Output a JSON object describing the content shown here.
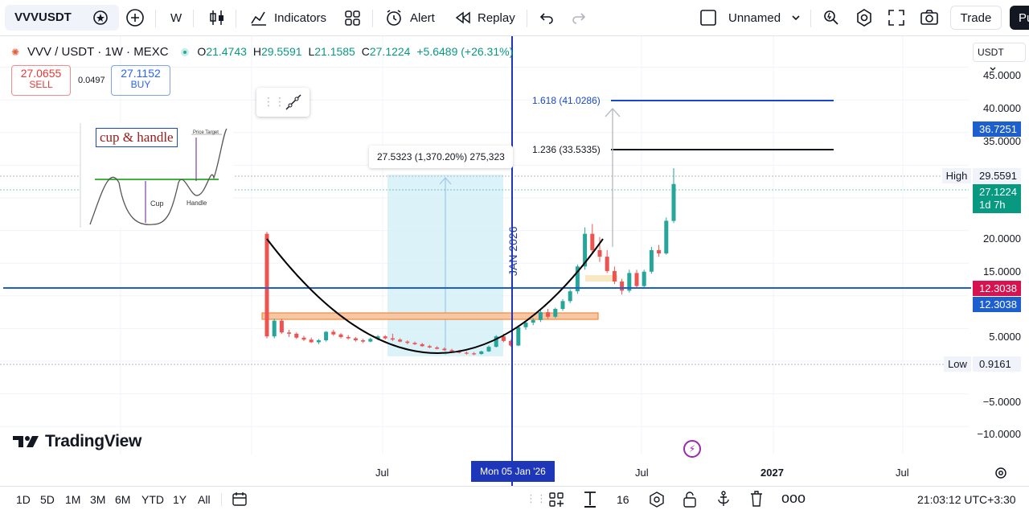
{
  "toolbar": {
    "symbol": "VVVUSDT",
    "interval": "W",
    "indicators_label": "Indicators",
    "alert_label": "Alert",
    "replay_label": "Replay",
    "layout_name": "Unnamed",
    "trade_label": "Trade",
    "publish_label": "Pu"
  },
  "legend": {
    "title": "VVV / USDT · 1W · MEXC",
    "o_key": "O",
    "o_val": "21.4743",
    "h_key": "H",
    "h_val": "29.5591",
    "l_key": "L",
    "l_val": "21.1585",
    "c_key": "C",
    "c_val": "27.1224",
    "change": "+5.6489 (+26.31%)"
  },
  "order": {
    "sell_price": "27.0655",
    "sell_label": "SELL",
    "spread": "0.0497",
    "buy_price": "27.1152",
    "buy_label": "BUY"
  },
  "annotations": {
    "cup_handle": "cup & handle",
    "price_target": "Price Target",
    "cup": "Cup",
    "handle": "Handle",
    "measure": "27.5323 (1,370.20%) 275,323",
    "fib_1618": "1.618 (41.0286)",
    "fib_1236": "1.236 (33.5335)",
    "vertical_label": "JAN 2026"
  },
  "price_axis": {
    "currency": "USDT",
    "ticks": [
      "45.0000",
      "40.0000",
      "35.0000",
      "20.0000",
      "15.0000",
      "5.0000",
      "−5.0000",
      "−10.0000"
    ],
    "tags": {
      "fib": "36.7251",
      "high_label": "High",
      "high": "29.5591",
      "last": "27.1224",
      "countdown": "1d 7h",
      "line_a": "12.3038",
      "line_b": "12.3038",
      "low_label": "Low",
      "low": "0.9161"
    }
  },
  "time_axis": {
    "labels": [
      "Jul",
      "Jul",
      "2027",
      "Jul"
    ],
    "crosshair": "Mon 05 Jan '26"
  },
  "branding": "TradingView",
  "bottom": {
    "ranges": [
      "1D",
      "5D",
      "1M",
      "3M",
      "6M",
      "YTD",
      "1Y",
      "All"
    ],
    "font_size": "16",
    "clock": "21:03:12 UTC+3:30"
  },
  "colors": {
    "up": "#26a69a",
    "down": "#ef5350",
    "blue": "#2962ff",
    "hline": "#1e5fd0",
    "fib_blue": "#1848cc",
    "tag_red": "#d6124f",
    "tag_blue": "#1e5fd0"
  },
  "chart_data": {
    "type": "candlestick",
    "title": "VVV / USDT · 1W · MEXC",
    "ylim": [
      -12,
      48
    ],
    "y_ticks": [
      45,
      40,
      35,
      20,
      15,
      5,
      -5,
      -10
    ],
    "candles": [
      {
        "o": 19.5,
        "h": 19.8,
        "l": 3.5,
        "c": 3.8
      },
      {
        "o": 3.8,
        "h": 6.5,
        "l": 3.5,
        "c": 6.2
      },
      {
        "o": 6.2,
        "h": 6.5,
        "l": 4.2,
        "c": 4.4
      },
      {
        "o": 4.4,
        "h": 4.8,
        "l": 3.7,
        "c": 4.2
      },
      {
        "o": 4.2,
        "h": 4.4,
        "l": 3.4,
        "c": 3.6
      },
      {
        "o": 3.6,
        "h": 3.9,
        "l": 3.1,
        "c": 3.3
      },
      {
        "o": 3.3,
        "h": 3.6,
        "l": 2.8,
        "c": 2.9
      },
      {
        "o": 2.9,
        "h": 3.4,
        "l": 2.6,
        "c": 3.2
      },
      {
        "o": 3.2,
        "h": 4.6,
        "l": 3.0,
        "c": 4.5
      },
      {
        "o": 4.5,
        "h": 4.8,
        "l": 3.9,
        "c": 4.1
      },
      {
        "o": 4.1,
        "h": 4.3,
        "l": 3.5,
        "c": 3.7
      },
      {
        "o": 3.7,
        "h": 4.0,
        "l": 3.3,
        "c": 3.5
      },
      {
        "o": 3.5,
        "h": 3.7,
        "l": 3.0,
        "c": 3.2
      },
      {
        "o": 3.2,
        "h": 3.4,
        "l": 2.8,
        "c": 3.0
      },
      {
        "o": 3.0,
        "h": 3.6,
        "l": 2.9,
        "c": 3.4
      },
      {
        "o": 3.4,
        "h": 4.0,
        "l": 3.2,
        "c": 3.8
      },
      {
        "o": 3.8,
        "h": 4.0,
        "l": 3.3,
        "c": 3.5
      },
      {
        "o": 3.5,
        "h": 4.2,
        "l": 3.1,
        "c": 3.3
      },
      {
        "o": 3.3,
        "h": 3.5,
        "l": 2.9,
        "c": 3.0
      },
      {
        "o": 3.0,
        "h": 3.2,
        "l": 2.6,
        "c": 2.8
      },
      {
        "o": 2.8,
        "h": 3.0,
        "l": 2.5,
        "c": 2.6
      },
      {
        "o": 2.6,
        "h": 2.8,
        "l": 2.2,
        "c": 2.3
      },
      {
        "o": 2.3,
        "h": 2.5,
        "l": 2.0,
        "c": 2.1
      },
      {
        "o": 2.1,
        "h": 2.3,
        "l": 1.8,
        "c": 1.9
      },
      {
        "o": 1.9,
        "h": 2.1,
        "l": 1.6,
        "c": 1.7
      },
      {
        "o": 1.7,
        "h": 1.9,
        "l": 1.4,
        "c": 1.5
      },
      {
        "o": 1.5,
        "h": 1.7,
        "l": 1.2,
        "c": 1.3
      },
      {
        "o": 1.3,
        "h": 1.5,
        "l": 1.0,
        "c": 1.2
      },
      {
        "o": 1.2,
        "h": 1.4,
        "l": 0.92,
        "c": 1.1
      },
      {
        "o": 1.1,
        "h": 1.6,
        "l": 1.0,
        "c": 1.5
      },
      {
        "o": 1.5,
        "h": 2.4,
        "l": 1.4,
        "c": 2.2
      },
      {
        "o": 2.2,
        "h": 4.0,
        "l": 2.1,
        "c": 3.8
      },
      {
        "o": 3.8,
        "h": 4.2,
        "l": 2.9,
        "c": 3.1
      },
      {
        "o": 3.1,
        "h": 3.3,
        "l": 2.2,
        "c": 2.4
      },
      {
        "o": 2.4,
        "h": 5.5,
        "l": 2.3,
        "c": 5.2
      },
      {
        "o": 5.2,
        "h": 6.2,
        "l": 4.8,
        "c": 5.9
      },
      {
        "o": 5.9,
        "h": 6.6,
        "l": 5.5,
        "c": 6.3
      },
      {
        "o": 6.3,
        "h": 7.8,
        "l": 6.0,
        "c": 7.5
      },
      {
        "o": 7.5,
        "h": 8.0,
        "l": 6.5,
        "c": 6.8
      },
      {
        "o": 6.8,
        "h": 8.2,
        "l": 6.6,
        "c": 8.0
      },
      {
        "o": 8.0,
        "h": 9.5,
        "l": 7.7,
        "c": 9.2
      },
      {
        "o": 9.2,
        "h": 11.0,
        "l": 8.9,
        "c": 10.7
      },
      {
        "o": 10.7,
        "h": 14.8,
        "l": 10.3,
        "c": 14.5
      },
      {
        "o": 14.5,
        "h": 20.5,
        "l": 14.0,
        "c": 19.5
      },
      {
        "o": 19.5,
        "h": 21.0,
        "l": 16.5,
        "c": 17.0
      },
      {
        "o": 17.0,
        "h": 19.0,
        "l": 15.2,
        "c": 16.0
      },
      {
        "o": 16.0,
        "h": 17.0,
        "l": 13.5,
        "c": 13.8
      },
      {
        "o": 13.8,
        "h": 14.5,
        "l": 11.8,
        "c": 12.2
      },
      {
        "o": 12.2,
        "h": 12.6,
        "l": 10.2,
        "c": 10.8
      },
      {
        "o": 10.8,
        "h": 14.0,
        "l": 10.5,
        "c": 13.5
      },
      {
        "o": 13.5,
        "h": 14.0,
        "l": 11.2,
        "c": 11.5
      },
      {
        "o": 11.5,
        "h": 14.0,
        "l": 11.3,
        "c": 13.7
      },
      {
        "o": 13.7,
        "h": 17.5,
        "l": 13.4,
        "c": 17.0
      },
      {
        "o": 17.0,
        "h": 17.8,
        "l": 16.0,
        "c": 16.5
      },
      {
        "o": 16.5,
        "h": 22.0,
        "l": 16.3,
        "c": 21.5
      },
      {
        "o": 21.4743,
        "h": 29.5591,
        "l": 21.1585,
        "c": 27.1224
      }
    ],
    "levels": {
      "fib_1618": 41.0286,
      "fib_1236": 33.5335,
      "horizontal": 12.3038,
      "high": 29.5591,
      "low": 0.9161
    }
  }
}
